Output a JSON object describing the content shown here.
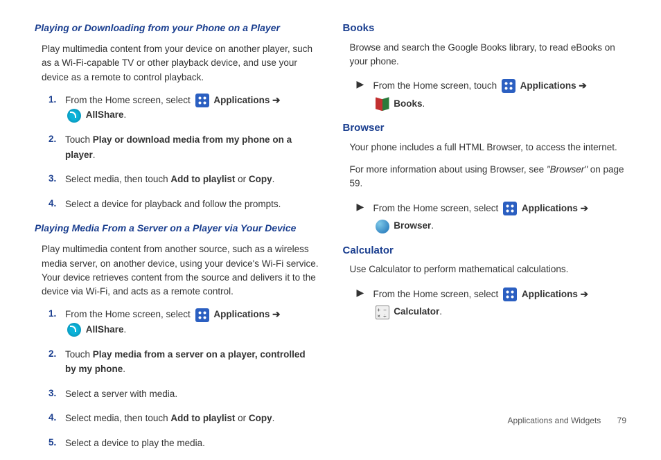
{
  "left": {
    "heading1": "Playing or Downloading from your Phone on a Player",
    "para1": "Play multimedia content from your device on another player, such as a Wi-Fi-capable TV or other playback device, and use your device as a remote to control playback.",
    "list1": {
      "n1": "1.",
      "c1a": "From the Home screen, select ",
      "c1b": "Applications ➔",
      "c1c": "AllShare",
      "c1d": ".",
      "n2": "2.",
      "c2a": "Touch ",
      "c2b": "Play or download media from my phone on a player",
      "c2c": ".",
      "n3": "3.",
      "c3a": "Select media, then touch ",
      "c3b": "Add to playlist",
      "c3c": " or ",
      "c3d": "Copy",
      "c3e": ".",
      "n4": "4.",
      "c4": "Select a device for playback and follow the prompts."
    },
    "heading2": "Playing Media From a Server on a Player via Your Device",
    "para2": "Play multimedia content from another source, such as a wireless media server, on another device, using your device's Wi-Fi service. Your device retrieves content from the source and delivers it to the device via Wi-Fi, and acts as a remote control.",
    "list2": {
      "n1": "1.",
      "c1a": "From the Home screen, select ",
      "c1b": "Applications ➔",
      "c1c": "AllShare",
      "c1d": ".",
      "n2": "2.",
      "c2a": "Touch ",
      "c2b": "Play media from a server on a player, controlled by my phone",
      "c2c": ".",
      "n3": "3.",
      "c3": "Select a server with media.",
      "n4": "4.",
      "c4a": "Select media, then touch ",
      "c4b": "Add to playlist",
      "c4c": " or ",
      "c4d": "Copy",
      "c4e": ".",
      "n5": "5.",
      "c5": "Select a device to play the media."
    }
  },
  "right": {
    "books": {
      "heading": "Books",
      "para": "Browse and search the Google Books library, to read eBooks on your phone.",
      "b1a": "From the Home screen, touch ",
      "b1b": "Applications ➔",
      "b1c": "Books",
      "b1d": "."
    },
    "browser": {
      "heading": "Browser",
      "para1": "Your phone includes a full HTML Browser, to access the internet.",
      "para2a": "For more information about using Browser, see ",
      "para2b": "\"Browser\"",
      "para2c": " on page 59.",
      "b1a": "From the Home screen, select ",
      "b1b": "Applications ➔",
      "b1c": "Browser",
      "b1d": "."
    },
    "calc": {
      "heading": "Calculator",
      "para": "Use Calculator to perform mathematical calculations.",
      "b1a": "From the Home screen, select ",
      "b1b": "Applications ➔",
      "b1c": "Calculator",
      "b1d": "."
    }
  },
  "footer": {
    "section": "Applications and Widgets",
    "page": "79"
  }
}
